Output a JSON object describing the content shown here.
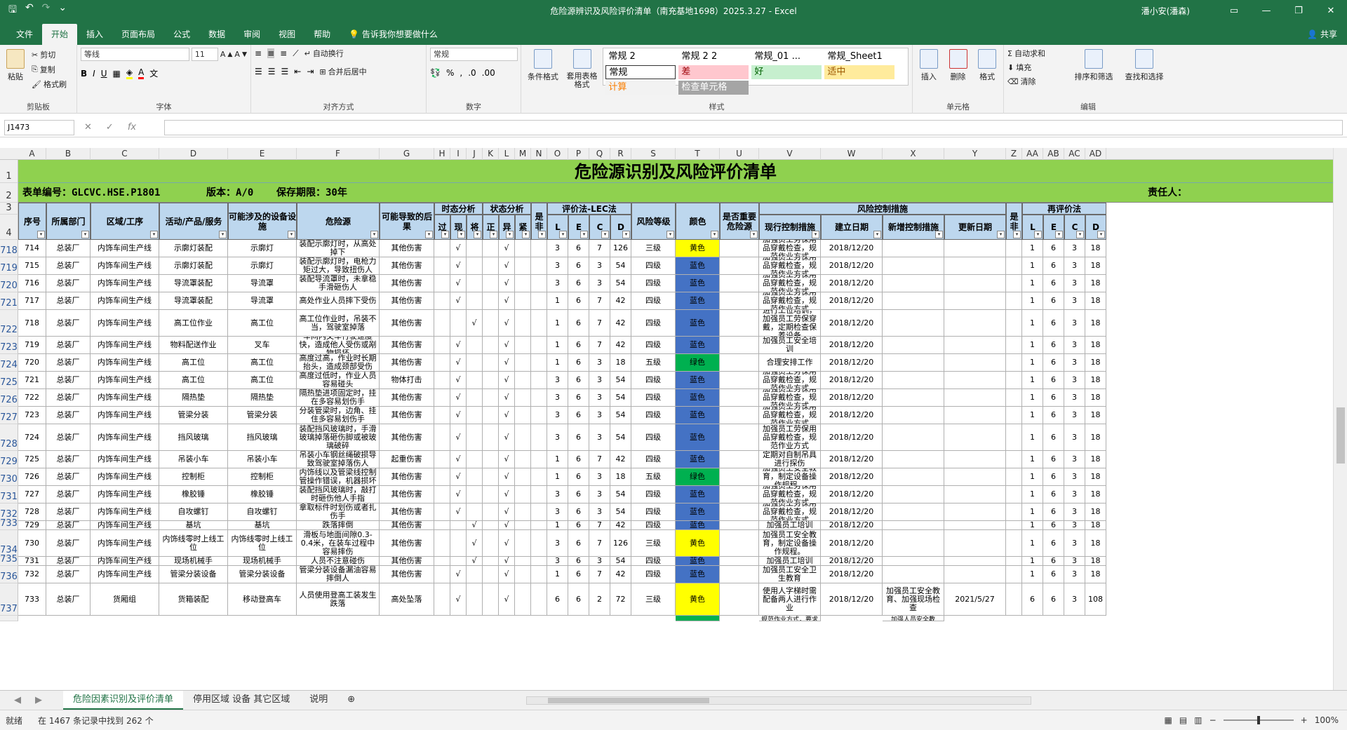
{
  "window": {
    "title": "危险源辨识及风险评价清单（南充基地1698）2025.3.27  -  Excel",
    "user": "潘小安(潘森)"
  },
  "menu": {
    "items": [
      "文件",
      "开始",
      "插入",
      "页面布局",
      "公式",
      "数据",
      "审阅",
      "视图",
      "帮助"
    ],
    "active": "开始",
    "tellme": "告诉我你想要做什么",
    "share": "共享"
  },
  "ribbon": {
    "clipboard": {
      "paste": "粘贴",
      "cut": "剪切",
      "copy": "复制",
      "painter": "格式刷",
      "label": "剪贴板"
    },
    "font": {
      "name": "等线",
      "size": "11",
      "label": "字体"
    },
    "align": {
      "wrap": "自动换行",
      "merge": "合并后居中",
      "label": "对齐方式"
    },
    "number": {
      "format": "常规",
      "label": "数字"
    },
    "styles": {
      "cond": "条件格式",
      "table": "套用表格格式",
      "label": "样式",
      "boxes": [
        {
          "t": "常规 2",
          "bg": "#ffffff",
          "c": "#000"
        },
        {
          "t": "常规 2 2",
          "bg": "#ffffff",
          "c": "#000"
        },
        {
          "t": "常规_01 ...",
          "bg": "#ffffff",
          "c": "#000"
        },
        {
          "t": "常规_Sheet1",
          "bg": "#ffffff",
          "c": "#000"
        },
        {
          "t": "常规",
          "bg": "#ffffff",
          "c": "#000"
        },
        {
          "t": "差",
          "bg": "#ffc7ce",
          "c": "#9c0006"
        },
        {
          "t": "好",
          "bg": "#c6efce",
          "c": "#006100"
        },
        {
          "t": "适中",
          "bg": "#ffeb9c",
          "c": "#9c5700"
        },
        {
          "t": "计算",
          "bg": "#f2f2f2",
          "c": "#fa7d00"
        },
        {
          "t": "检查单元格",
          "bg": "#a5a5a5",
          "c": "#ffffff"
        }
      ]
    },
    "cells": {
      "insert": "插入",
      "delete": "删除",
      "format": "格式",
      "label": "单元格"
    },
    "edit": {
      "autosum": "自动求和",
      "fill": "填充",
      "clear": "清除",
      "sort": "排序和筛选",
      "find": "查找和选择",
      "label": "编辑"
    }
  },
  "formula": {
    "namebox": "J1473",
    "fx": "fx",
    "value": ""
  },
  "columns": [
    "A",
    "B",
    "C",
    "D",
    "E",
    "F",
    "G",
    "H",
    "I",
    "J",
    "K",
    "L",
    "M",
    "N",
    "O",
    "P",
    "Q",
    "R",
    "S",
    "T",
    "U",
    "V",
    "W",
    "X",
    "Y",
    "Z",
    "AA",
    "AB",
    "AC",
    "AD"
  ],
  "sheet": {
    "title": "危险源识别及风险评价清单",
    "form_no": "表单编号：GLCVC.HSE.P1801",
    "version": "版本：A/0",
    "keep": "保存期限：30年",
    "owner": "责任人：",
    "headers": {
      "seq": "序号",
      "dept": "所属部门",
      "area": "区域/工序",
      "activity": "活动/产品/服务",
      "equip": "可能涉及的设备设施",
      "hazard": "危险源",
      "result": "可能导致的后果",
      "state": "时态分析",
      "st1": "过",
      "st2": "现",
      "st3": "将",
      "cond": "状态分析",
      "c1": "正",
      "c2": "异",
      "c3": "紧",
      "major": "是非",
      "lec": "评价法-LEC法",
      "l": "L",
      "e": "E",
      "c": "C",
      "d": "D",
      "level": "风险等级",
      "color": "颜色",
      "important": "是否重要危险源",
      "ctrl": "风险控制措施",
      "cur": "现行控制措施",
      "date": "建立日期",
      "newm": "新增控制措施",
      "upd": "更新日期",
      "z": "是非",
      "re": "再评价法"
    },
    "rows": [
      {
        "r": "718",
        "n": "714",
        "dept": "总装厂",
        "area": "内饰车间生产线",
        "act": "示廓灯装配",
        "eq": "示廓灯",
        "hz": "装配示廓灯时，从高处掉下",
        "res": "其他伤害",
        "h": "",
        "i": "√",
        "j": "",
        "k": "",
        "l": "√",
        "m": "",
        "L": "3",
        "E": "6",
        "C": "7",
        "D": "126",
        "lv": "三级",
        "col": "黄色",
        "cur": "加强员工劳保用品穿戴检查，规范作业方式",
        "dt": "2018/12/20",
        "nm": "",
        "ud": "",
        "L2": "1",
        "E2": "6",
        "C2": "3",
        "D2": "18"
      },
      {
        "r": "719",
        "n": "715",
        "dept": "总装厂",
        "area": "内饰车间生产线",
        "act": "示廓灯装配",
        "eq": "示廓灯",
        "hz": "装配示廓灯时，电枪力矩过大，导致扭伤人",
        "res": "其他伤害",
        "h": "",
        "i": "√",
        "j": "",
        "k": "",
        "l": "√",
        "m": "",
        "L": "3",
        "E": "6",
        "C": "3",
        "D": "54",
        "lv": "四级",
        "col": "蓝色",
        "cur": "加强员工劳保用品穿戴检查，规范作业方式",
        "dt": "2018/12/20",
        "nm": "",
        "ud": "",
        "L2": "1",
        "E2": "6",
        "C2": "3",
        "D2": "18"
      },
      {
        "r": "720",
        "n": "716",
        "dept": "总装厂",
        "area": "内饰车间生产线",
        "act": "导流罩装配",
        "eq": "导流罩",
        "hz": "装配导流罩时，未拿稳手滑砸伤人",
        "res": "其他伤害",
        "h": "",
        "i": "√",
        "j": "",
        "k": "",
        "l": "√",
        "m": "",
        "L": "3",
        "E": "6",
        "C": "3",
        "D": "54",
        "lv": "四级",
        "col": "蓝色",
        "cur": "加强员工劳保用品穿戴检查，规范作业方式",
        "dt": "2018/12/20",
        "nm": "",
        "ud": "",
        "L2": "1",
        "E2": "6",
        "C2": "3",
        "D2": "18"
      },
      {
        "r": "721",
        "n": "717",
        "dept": "总装厂",
        "area": "内饰车间生产线",
        "act": "导流罩装配",
        "eq": "导流罩",
        "hz": "高处作业人员摔下受伤",
        "res": "其他伤害",
        "h": "",
        "i": "√",
        "j": "",
        "k": "",
        "l": "√",
        "m": "",
        "L": "1",
        "E": "6",
        "C": "7",
        "D": "42",
        "lv": "四级",
        "col": "蓝色",
        "cur": "加强员工劳保用品穿戴检查，规范作业方式",
        "dt": "2018/12/20",
        "nm": "",
        "ud": "",
        "L2": "1",
        "E2": "6",
        "C2": "3",
        "D2": "18"
      },
      {
        "r": "722",
        "n": "718",
        "dept": "总装厂",
        "area": "内饰车间生产线",
        "act": "高工位作业",
        "eq": "高工位",
        "hz": "高工位作业时，吊装不当，驾驶室掉落",
        "res": "其他伤害",
        "h": "",
        "i": "",
        "j": "√",
        "k": "",
        "l": "√",
        "m": "",
        "L": "1",
        "E": "6",
        "C": "7",
        "D": "42",
        "lv": "四级",
        "col": "蓝色",
        "cur": "进行工位培训，加强员工劳保穿戴，定期检查保养设备",
        "dt": "2018/12/20",
        "nm": "",
        "ud": "",
        "L2": "1",
        "E2": "6",
        "C2": "3",
        "D2": "18"
      },
      {
        "r": "723",
        "n": "719",
        "dept": "总装厂",
        "area": "内饰车间生产线",
        "act": "物料配送作业",
        "eq": "叉车",
        "hz": "车间内叉车行驶速度快，造成他人受伤或剐物损坏",
        "res": "其他伤害",
        "h": "",
        "i": "√",
        "j": "",
        "k": "",
        "l": "√",
        "m": "",
        "L": "1",
        "E": "6",
        "C": "7",
        "D": "42",
        "lv": "四级",
        "col": "蓝色",
        "cur": "加强员工安全培训",
        "dt": "2018/12/20",
        "nm": "",
        "ud": "",
        "L2": "1",
        "E2": "6",
        "C2": "3",
        "D2": "18"
      },
      {
        "r": "724",
        "n": "720",
        "dept": "总装厂",
        "area": "内饰车间生产线",
        "act": "高工位",
        "eq": "高工位",
        "hz": "高度过高，作业时长期抬头，造成颈部受伤",
        "res": "其他伤害",
        "h": "",
        "i": "√",
        "j": "",
        "k": "",
        "l": "√",
        "m": "",
        "L": "1",
        "E": "6",
        "C": "3",
        "D": "18",
        "lv": "五级",
        "col": "绿色",
        "cur": "合理安排工作",
        "dt": "2018/12/20",
        "nm": "",
        "ud": "",
        "L2": "1",
        "E2": "6",
        "C2": "3",
        "D2": "18"
      },
      {
        "r": "725",
        "n": "721",
        "dept": "总装厂",
        "area": "内饰车间生产线",
        "act": "高工位",
        "eq": "高工位",
        "hz": "高度过低时，作业人员容易碰头",
        "res": "物体打击",
        "h": "",
        "i": "√",
        "j": "",
        "k": "",
        "l": "√",
        "m": "",
        "L": "3",
        "E": "6",
        "C": "3",
        "D": "54",
        "lv": "四级",
        "col": "蓝色",
        "cur": "加强员工劳保用品穿戴检查，规范作业方式",
        "dt": "2018/12/20",
        "nm": "",
        "ud": "",
        "L2": "1",
        "E2": "6",
        "C2": "3",
        "D2": "18"
      },
      {
        "r": "726",
        "n": "722",
        "dept": "总装厂",
        "area": "内饰车间生产线",
        "act": "隔热垫",
        "eq": "隔热垫",
        "hz": "隔热垫进项固定时，挂在多容易划伤手",
        "res": "其他伤害",
        "h": "",
        "i": "√",
        "j": "",
        "k": "",
        "l": "√",
        "m": "",
        "L": "3",
        "E": "6",
        "C": "3",
        "D": "54",
        "lv": "四级",
        "col": "蓝色",
        "cur": "加强员工劳保用品穿戴检查，规范作业方式",
        "dt": "2018/12/20",
        "nm": "",
        "ud": "",
        "L2": "1",
        "E2": "6",
        "C2": "3",
        "D2": "18"
      },
      {
        "r": "727",
        "n": "723",
        "dept": "总装厂",
        "area": "内饰车间生产线",
        "act": "管梁分装",
        "eq": "管梁分装",
        "hz": "分装管梁时，边角、挂住多容易划伤手",
        "res": "其他伤害",
        "h": "",
        "i": "√",
        "j": "",
        "k": "",
        "l": "√",
        "m": "",
        "L": "3",
        "E": "6",
        "C": "3",
        "D": "54",
        "lv": "四级",
        "col": "蓝色",
        "cur": "加强员工劳保用品穿戴检查，规范作业方式",
        "dt": "2018/12/20",
        "nm": "",
        "ud": "",
        "L2": "1",
        "E2": "6",
        "C2": "3",
        "D2": "18"
      },
      {
        "r": "728",
        "n": "724",
        "dept": "总装厂",
        "area": "内饰车间生产线",
        "act": "挡风玻璃",
        "eq": "挡风玻璃",
        "hz": "装配挡风玻璃时，手滑玻璃掉落砸伤脚或被玻璃破碎",
        "res": "其他伤害",
        "h": "",
        "i": "√",
        "j": "",
        "k": "",
        "l": "√",
        "m": "",
        "L": "3",
        "E": "6",
        "C": "3",
        "D": "54",
        "lv": "四级",
        "col": "蓝色",
        "cur": "加强员工劳保用品穿戴检查，规范作业方式",
        "dt": "2018/12/20",
        "nm": "",
        "ud": "",
        "L2": "1",
        "E2": "6",
        "C2": "3",
        "D2": "18"
      },
      {
        "r": "729",
        "n": "725",
        "dept": "总装厂",
        "area": "内饰车间生产线",
        "act": "吊装小车",
        "eq": "吊装小车",
        "hz": "吊装小车钢丝绳破损导致驾驶室掉落伤人",
        "res": "起重伤害",
        "h": "",
        "i": "√",
        "j": "",
        "k": "",
        "l": "√",
        "m": "",
        "L": "1",
        "E": "6",
        "C": "7",
        "D": "42",
        "lv": "四级",
        "col": "蓝色",
        "cur": "定期对自制吊具进行探伤",
        "dt": "2018/12/20",
        "nm": "",
        "ud": "",
        "L2": "1",
        "E2": "6",
        "C2": "3",
        "D2": "18"
      },
      {
        "r": "730",
        "n": "726",
        "dept": "总装厂",
        "area": "内饰车间生产线",
        "act": "控制柜",
        "eq": "控制柜",
        "hz": "内饰线以及管梁线控制管操作错误，机器损坏",
        "res": "其他伤害",
        "h": "",
        "i": "√",
        "j": "",
        "k": "",
        "l": "√",
        "m": "",
        "L": "1",
        "E": "6",
        "C": "3",
        "D": "18",
        "lv": "五级",
        "col": "绿色",
        "cur": "加强员工安全教育，制定设备操作规程。",
        "dt": "2018/12/20",
        "nm": "",
        "ud": "",
        "L2": "1",
        "E2": "6",
        "C2": "3",
        "D2": "18"
      },
      {
        "r": "731",
        "n": "727",
        "dept": "总装厂",
        "area": "内饰车间生产线",
        "act": "橡胶锤",
        "eq": "橡胶锤",
        "hz": "装配挡风玻璃时，敲打时砸伤他人手指",
        "res": "其他伤害",
        "h": "",
        "i": "√",
        "j": "",
        "k": "",
        "l": "√",
        "m": "",
        "L": "3",
        "E": "6",
        "C": "3",
        "D": "54",
        "lv": "四级",
        "col": "蓝色",
        "cur": "加强员工劳保用品穿戴检查，规范作业方式",
        "dt": "2018/12/20",
        "nm": "",
        "ud": "",
        "L2": "1",
        "E2": "6",
        "C2": "3",
        "D2": "18"
      },
      {
        "r": "732",
        "n": "728",
        "dept": "总装厂",
        "area": "内饰车间生产线",
        "act": "自攻螺钉",
        "eq": "自攻螺钉",
        "hz": "拿取标件时划伤或者扎伤手",
        "res": "其他伤害",
        "h": "",
        "i": "√",
        "j": "",
        "k": "",
        "l": "√",
        "m": "",
        "L": "3",
        "E": "6",
        "C": "3",
        "D": "54",
        "lv": "四级",
        "col": "蓝色",
        "cur": "加强员工劳保用品穿戴检查，规范作业方式",
        "dt": "2018/12/20",
        "nm": "",
        "ud": "",
        "L2": "1",
        "E2": "6",
        "C2": "3",
        "D2": "18"
      },
      {
        "r": "733",
        "n": "729",
        "dept": "总装厂",
        "area": "内饰车间生产线",
        "act": "基坑",
        "eq": "基坑",
        "hz": "跌落摔倒",
        "res": "其他伤害",
        "h": "",
        "i": "",
        "j": "√",
        "k": "",
        "l": "√",
        "m": "",
        "L": "1",
        "E": "6",
        "C": "7",
        "D": "42",
        "lv": "四级",
        "col": "蓝色",
        "cur": "加强员工培训",
        "dt": "2018/12/20",
        "nm": "",
        "ud": "",
        "L2": "1",
        "E2": "6",
        "C2": "3",
        "D2": "18"
      },
      {
        "r": "734",
        "n": "730",
        "dept": "总装厂",
        "area": "内饰车间生产线",
        "act": "内饰线零时上线工位",
        "eq": "内饰线零时上线工位",
        "hz": "滑板与地面间隙0.3-0.4米，在装车过程中容易摔伤",
        "res": "其他伤害",
        "h": "",
        "i": "",
        "j": "√",
        "k": "",
        "l": "√",
        "m": "",
        "L": "3",
        "E": "6",
        "C": "7",
        "D": "126",
        "lv": "三级",
        "col": "黄色",
        "cur": "加强员工安全教育，制定设备操作规程。",
        "dt": "2018/12/20",
        "nm": "",
        "ud": "",
        "L2": "1",
        "E2": "6",
        "C2": "3",
        "D2": "18"
      },
      {
        "r": "735",
        "n": "731",
        "dept": "总装厂",
        "area": "内饰车间生产线",
        "act": "现场机械手",
        "eq": "现场机械手",
        "hz": "人员不注意碰伤",
        "res": "其他伤害",
        "h": "",
        "i": "",
        "j": "√",
        "k": "",
        "l": "√",
        "m": "",
        "L": "3",
        "E": "6",
        "C": "3",
        "D": "54",
        "lv": "四级",
        "col": "蓝色",
        "cur": "加强员工培训",
        "dt": "2018/12/20",
        "nm": "",
        "ud": "",
        "L2": "1",
        "E2": "6",
        "C2": "3",
        "D2": "18"
      },
      {
        "r": "736",
        "n": "732",
        "dept": "总装厂",
        "area": "内饰车间生产线",
        "act": "管梁分装设备",
        "eq": "管梁分装设备",
        "hz": "管梁分装设备漏油容易摔倒人",
        "res": "其他伤害",
        "h": "",
        "i": "√",
        "j": "",
        "k": "",
        "l": "√",
        "m": "",
        "L": "1",
        "E": "6",
        "C": "7",
        "D": "42",
        "lv": "四级",
        "col": "蓝色",
        "cur": "加强员工安全卫生教育",
        "dt": "2018/12/20",
        "nm": "",
        "ud": "",
        "L2": "1",
        "E2": "6",
        "C2": "3",
        "D2": "18"
      },
      {
        "r": "737",
        "n": "733",
        "dept": "总装厂",
        "area": "货厢组",
        "act": "货箱装配",
        "eq": "移动登高车",
        "hz": "人员使用登高工装发生跌落",
        "res": "高处坠落",
        "h": "",
        "i": "√",
        "j": "",
        "k": "",
        "l": "√",
        "m": "",
        "L": "6",
        "E": "6",
        "C": "2",
        "D": "72",
        "lv": "三级",
        "col": "黄色",
        "cur": "使用人字梯时需配备两人进行作业",
        "dt": "2018/12/20",
        "nm": "加强员工安全教育、加强现场检查",
        "ud": "2021/5/27",
        "L2": "6",
        "E2": "6",
        "C2": "3",
        "D2": "108"
      }
    ],
    "partial_row": {
      "cur": "规范作业方式，要求员工",
      "nm": "加强人员安全教"
    }
  },
  "colors": {
    "yellow": "#ffff00",
    "blue": "#4472c4",
    "green": "#00b050",
    "header_bg": "#bdd7ee",
    "title_bg": "#8fd14f",
    "excel": "#217346"
  },
  "tabs": [
    "危险因素识别及评价清单",
    "停用区域 设备 其它区域",
    "说明"
  ],
  "status": {
    "ready": "就绪",
    "filter": "在 1467 条记录中找到 262 个",
    "zoom": "100%"
  }
}
